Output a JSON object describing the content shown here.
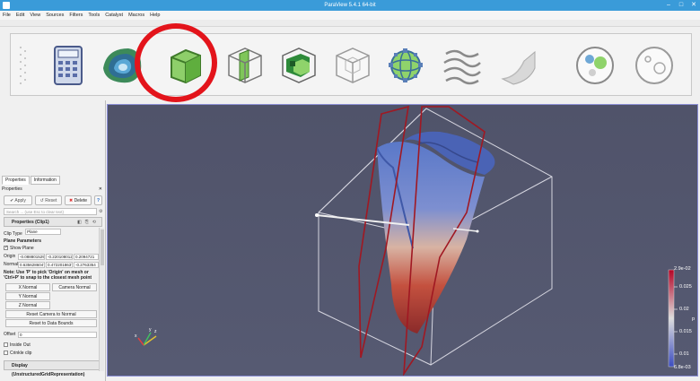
{
  "window": {
    "title": "ParaView 5.4.1 64-bit"
  },
  "menu": [
    "File",
    "Edit",
    "View",
    "Sources",
    "Filters",
    "Tools",
    "Catalyst",
    "Macros",
    "Help"
  ],
  "toolbar": {
    "filters": [
      {
        "name": "calculator-filter-icon"
      },
      {
        "name": "contour-filter-icon"
      },
      {
        "name": "clip-filter-icon",
        "highlighted": true
      },
      {
        "name": "slice-filter-icon"
      },
      {
        "name": "threshold-filter-icon"
      },
      {
        "name": "extract-subset-filter-icon"
      },
      {
        "name": "glyph-filter-icon"
      },
      {
        "name": "stream-tracer-filter-icon"
      },
      {
        "name": "warp-by-vector-filter-icon"
      },
      {
        "name": "group-datasets-filter-icon"
      },
      {
        "name": "extract-level-filter-icon"
      }
    ],
    "highlight_color": "#e3141b"
  },
  "left_panel": {
    "tabs": [
      "Properties",
      "Information"
    ],
    "header": "Properties",
    "buttons": {
      "apply": "Apply",
      "reset": "Reset",
      "delete": "Delete",
      "help": "?"
    },
    "search_placeholder": "Search ... (use Esc to clear text)",
    "section_title": "Properties (Clip1)",
    "clip_type_label": "Clip Type",
    "clip_type_value": "Plane",
    "plane_params_title": "Plane Parameters",
    "show_plane_label": "Show Plane",
    "origin_label": "Origin",
    "origin_values": [
      "-0.0888015294",
      "-0.220108012",
      "0.2094721"
    ],
    "normal_label": "Normal",
    "normal_values": [
      "0.635628604741",
      "0.47220186379",
      "-0.2763354"
    ],
    "note": "Note: Use 'P' to pick 'Origin' on mesh or 'Ctrl+P' to snap to the closest mesh point",
    "x_normal": "X Normal",
    "camera_normal": "Camera Normal",
    "y_normal": "Y Normal",
    "z_normal": "Z Normal",
    "reset_camera_normal": "Reset Camera to Normal",
    "reset_bounds": "Reset to Data Bounds",
    "offset_label": "Offset",
    "offset_value": "0",
    "inside_out_label": "Inside Out",
    "crinkle_clip_label": "Crinkle clip",
    "display_section": "Display (UnstructuredGridRepresentation)"
  },
  "colorbar": {
    "max_label": "2.9e-02",
    "ticks": [
      "0.025",
      "0.02",
      "0.015",
      "0.01"
    ],
    "min_label": "6.8e-03",
    "title": "p",
    "colors": {
      "high": "#b40426",
      "mid": "#dddddd",
      "low": "#3b4cc0"
    }
  },
  "viewport": {
    "background": "#52566e",
    "border": "#8c8fd6"
  }
}
